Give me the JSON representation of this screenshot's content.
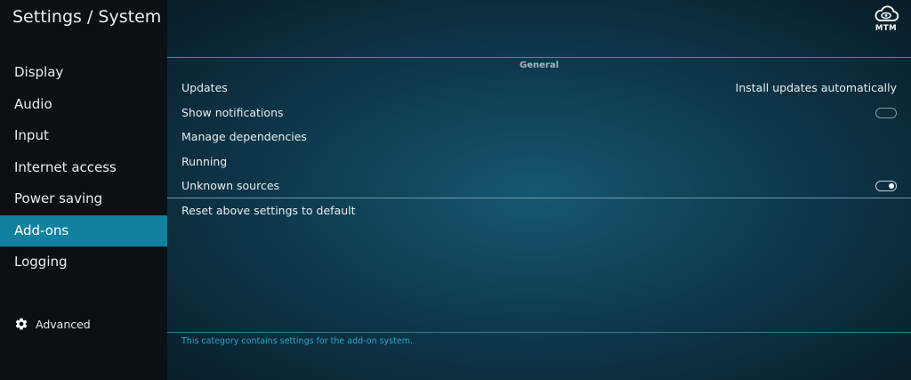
{
  "header": {
    "title": "Settings / System",
    "logo_text": "MTM",
    "logo_icon": "cloud-eye-icon"
  },
  "sidebar": {
    "items": [
      {
        "label": "Display"
      },
      {
        "label": "Audio"
      },
      {
        "label": "Input"
      },
      {
        "label": "Internet access"
      },
      {
        "label": "Power saving"
      },
      {
        "label": "Add-ons",
        "active": true
      },
      {
        "label": "Logging"
      }
    ],
    "advanced_label": "Advanced",
    "advanced_icon": "gear-icon"
  },
  "main": {
    "section_title": "General",
    "settings": [
      {
        "label": "Updates",
        "value": "Install updates automatically"
      },
      {
        "label": "Show notifications",
        "toggle": "off"
      },
      {
        "label": "Manage dependencies"
      },
      {
        "label": "Running"
      },
      {
        "label": "Unknown sources",
        "toggle": "on"
      }
    ],
    "reset_label": "Reset above settings to default",
    "description": "This category contains settings for the add-on system."
  },
  "colors": {
    "accent": "#12809f",
    "sidebar_bg": "#0a1014",
    "description_text": "#2aa7c9"
  }
}
